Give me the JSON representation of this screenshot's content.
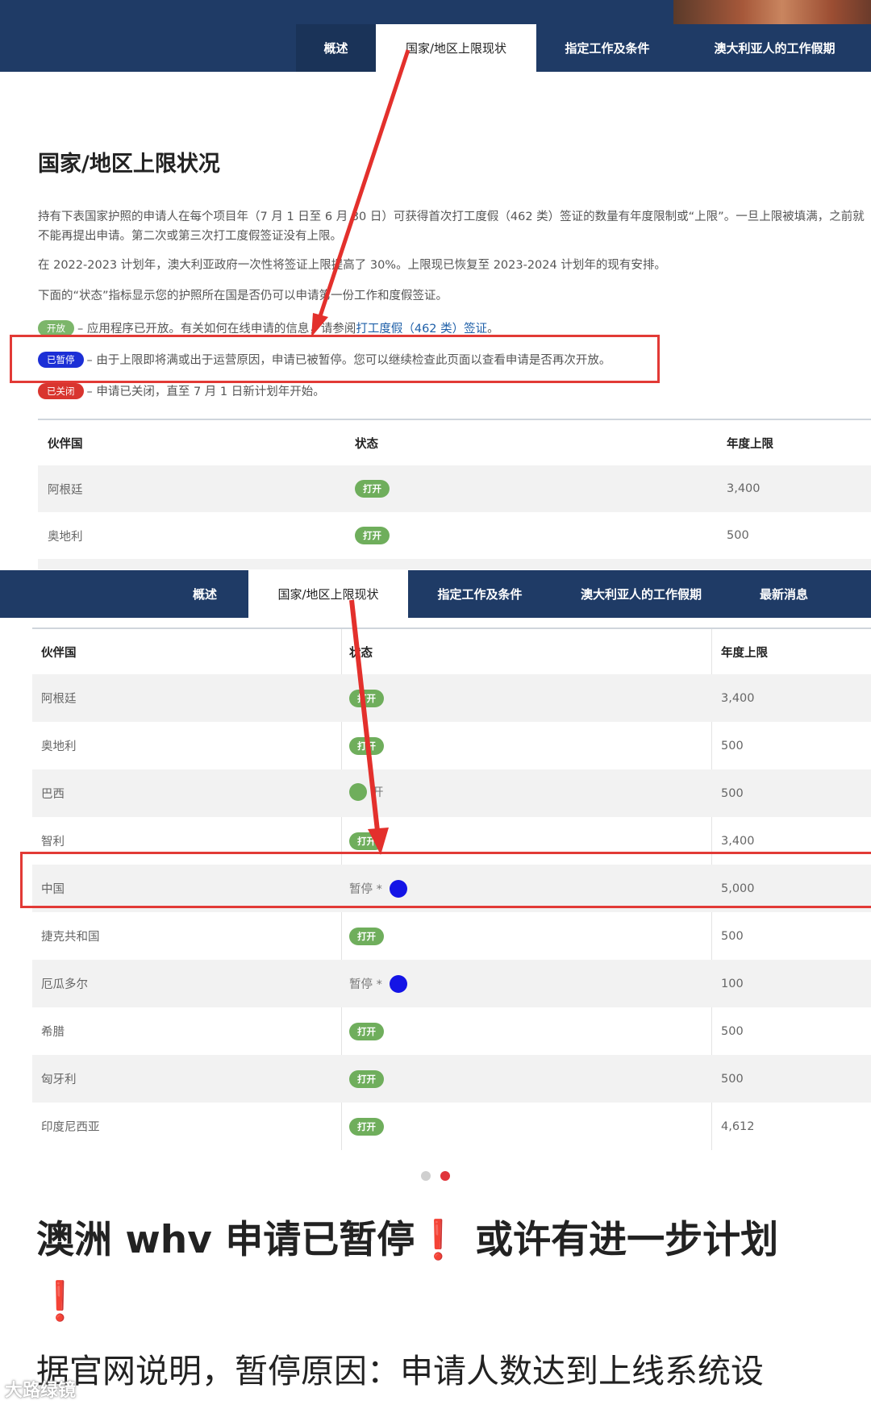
{
  "nav_top": {
    "tabs": [
      "概述",
      "国家/地区上限现状",
      "指定工作及条件",
      "澳大利亚人的工作假期"
    ],
    "active_index": 1
  },
  "screenshot1": {
    "page_title": "国家/地区上限状况",
    "para1": "持有下表国家护照的申请人在每个项目年（7 月 1 日至 6 月 30 日）可获得首次打工度假（462 类）签证的数量有年度限制或“上限”。一旦上限被填满，之前就不能再提出申请。第二次或第三次打工度假签证没有上限。",
    "para2": "在 2022-2023 计划年，澳大利亚政府一次性将签证上限提高了 30%。上限现已恢复至 2023-2024 计划年的现有安排。",
    "para3": "下面的“状态”指标显示您的护照所在国是否仍可以申请第一份工作和度假签证。",
    "legend": {
      "open_pill": "开放",
      "open_text": "– 应用程序已开放。有关如何在线申请的信息，请参阅",
      "open_link": "打工度假（462 类）签证",
      "open_end": "。",
      "paused_pill": "已暂停",
      "paused_text": "– 由于上限即将满或出于运营原因，申请已被暂停。您可以继续检查此页面以查看申请是否再次开放。",
      "closed_pill": "已关闭",
      "closed_text": "– 申请已关闭，直至 7 月 1 日新计划年开始。"
    },
    "table": {
      "headers": [
        "伙伴国",
        "状态",
        "年度上限"
      ],
      "rows": [
        {
          "country": "阿根廷",
          "status": "打开",
          "cap": "3,400"
        },
        {
          "country": "奥地利",
          "status": "打开",
          "cap": "500"
        }
      ]
    }
  },
  "nav_bottom": {
    "tabs": [
      "概述",
      "国家/地区上限现状",
      "指定工作及条件",
      "澳大利亚人的工作假期",
      "最新消息"
    ],
    "active_index": 1
  },
  "screenshot2": {
    "table": {
      "headers": [
        "伙伴国",
        "状态",
        "年度上限"
      ],
      "rows": [
        {
          "country": "阿根廷",
          "status": "打开",
          "status_type": "open",
          "cap": "3,400"
        },
        {
          "country": "奥地利",
          "status": "打开",
          "status_type": "open",
          "cap": "500"
        },
        {
          "country": "巴西",
          "status": "开",
          "status_type": "open-plain",
          "cap": "500"
        },
        {
          "country": "智利",
          "status": "打开",
          "status_type": "open",
          "cap": "3,400"
        },
        {
          "country": "中国",
          "status": "暂停 *",
          "status_type": "paused",
          "cap": "5,000"
        },
        {
          "country": "捷克共和国",
          "status": "打开",
          "status_type": "open",
          "cap": "500"
        },
        {
          "country": "厄瓜多尔",
          "status": "暂停 *",
          "status_type": "paused",
          "cap": "100"
        },
        {
          "country": "希腊",
          "status": "打开",
          "status_type": "open",
          "cap": "500"
        },
        {
          "country": "匈牙利",
          "status": "打开",
          "status_type": "open",
          "cap": "500"
        },
        {
          "country": "印度尼西亚",
          "status": "打开",
          "status_type": "open",
          "cap": "4,612"
        }
      ]
    }
  },
  "carousel": {
    "count": 2,
    "active_index": 1
  },
  "post": {
    "headline_part1": "澳洲 whv 申请已暂停",
    "headline_excl": "❗",
    "headline_part2": "或许有进一步计划",
    "subline": "据官网说明，暂停原因：申请人数达到上线系统设",
    "watermark": "大路绿镜"
  },
  "colors": {
    "nav_bg": "#1f3b66",
    "open_green": "#6fae5c",
    "paused_blue": "#1414e6",
    "closed_red": "#d9352f",
    "highlight_red": "#e23a36"
  }
}
